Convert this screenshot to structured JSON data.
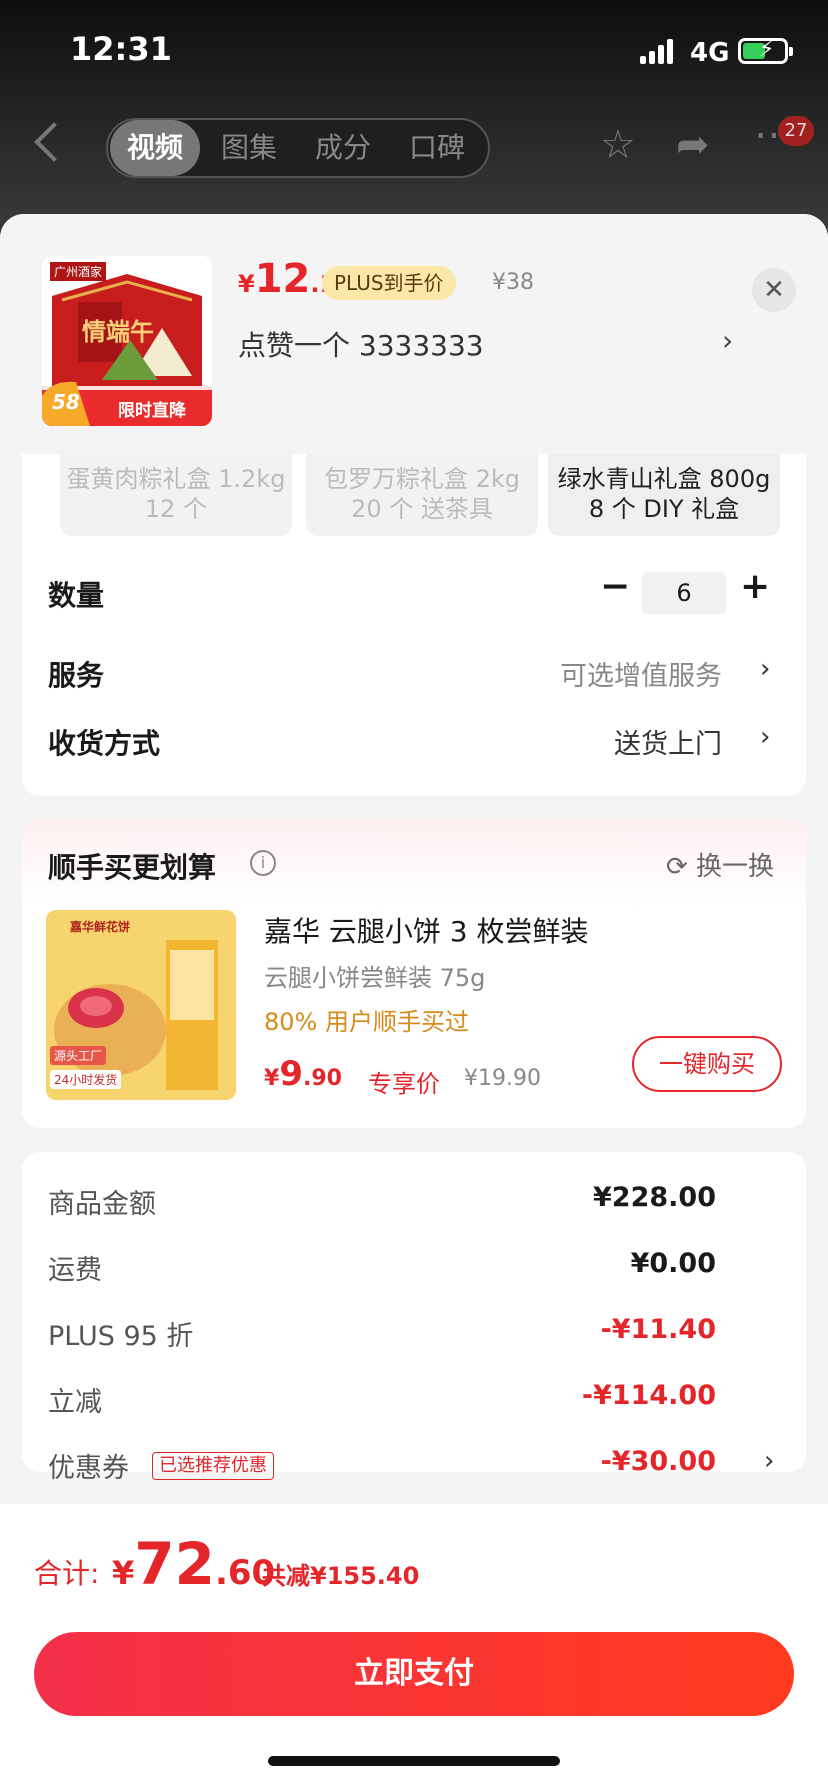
{
  "status": {
    "time": "12:31",
    "network": "4G"
  },
  "nav": {
    "tabs": [
      "视频",
      "图集",
      "成分",
      "口碑"
    ],
    "active_tab": "视频",
    "badge": "27"
  },
  "product": {
    "thumb_brand": "广州酒家",
    "thumb_title": "情端午",
    "thumb_tag_number": "58",
    "thumb_tag": "限时直降",
    "price_yen": "¥",
    "price_int": "12",
    "price_dec": ".1",
    "plus_tag": "PLUS到手价",
    "orig_price": "¥38",
    "likes": "点赞一个  3333333",
    "close": "✕",
    "arrow": "›"
  },
  "variants": [
    {
      "line1": "蛋黄肉粽礼盒 1.2kg",
      "line2": "12 个",
      "selected": false
    },
    {
      "line1": "包罗万粽礼盒 2kg",
      "line2": "20 个 送茶具",
      "selected": false
    },
    {
      "line1": "绿水青山礼盒 800g",
      "line2": "8 个 DIY 礼盒",
      "selected": true
    }
  ],
  "quantity": {
    "label": "数量",
    "value": "6",
    "minus": "−",
    "plus": "+"
  },
  "service": {
    "label": "服务",
    "value": "可选增值服务",
    "arrow": "›"
  },
  "delivery": {
    "label": "收货方式",
    "value": "送货上门",
    "arrow": "›"
  },
  "recommend": {
    "title": "顺手买更划算",
    "info": "i",
    "refresh": "⟳ 换一换",
    "thumb_brand": "嘉华鲜花饼",
    "thumb_badge1": "源头工厂",
    "thumb_badge2": "24小时发货",
    "name": "嘉华 云腿小饼 3 枚尝鲜装",
    "spec": "云腿小饼尝鲜装 75g",
    "rate": "80% 用户顺手买过",
    "price_yen": "¥",
    "price_int": "9",
    "price_dec": ".90",
    "exclusive": "专享价",
    "orig_price": "¥19.90",
    "buy_button": "一键购买"
  },
  "fees": [
    {
      "label": "商品金额",
      "value": "¥228.00",
      "red": false
    },
    {
      "label": "运费",
      "value": "¥0.00",
      "red": false
    },
    {
      "label": "PLUS 95 折",
      "value": "-¥11.40",
      "red": true
    },
    {
      "label": "立减",
      "value": "-¥114.00",
      "red": true
    },
    {
      "label": "优惠券",
      "value": "-¥30.00",
      "red": true,
      "tag": "已选推荐优惠",
      "arrow": "›"
    }
  ],
  "total": {
    "label": "合计:",
    "yen": "¥",
    "int": "72",
    "dec": ".60",
    "saved": "共减¥155.40"
  },
  "pay_button": "立即支付",
  "colors": {
    "accent": "#e4262b",
    "pay_gradient_start": "#f4304a",
    "pay_gradient_end": "#ff3a1e"
  }
}
